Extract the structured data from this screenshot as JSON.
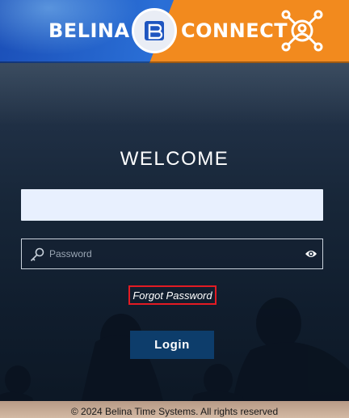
{
  "header": {
    "brand_left": "BELINA",
    "brand_right": "CONNECT",
    "logo_icon": "belina-b-logo-icon",
    "connect_icon": "network-people-icon",
    "colors": {
      "blue": "#1e55c0",
      "orange": "#f28a1e"
    }
  },
  "login": {
    "heading": "WELCOME",
    "username_value": "",
    "password_placeholder": "Password",
    "password_icon": "key-icon",
    "show_password_icon": "eye-icon",
    "forgot_password": "Forgot Password",
    "login_button": "Login",
    "colors": {
      "button": "#0d3d6b",
      "focus_outline": "#e31b23"
    }
  },
  "footer": {
    "copyright": "© 2024 Belina Time Systems. All rights reserved"
  }
}
